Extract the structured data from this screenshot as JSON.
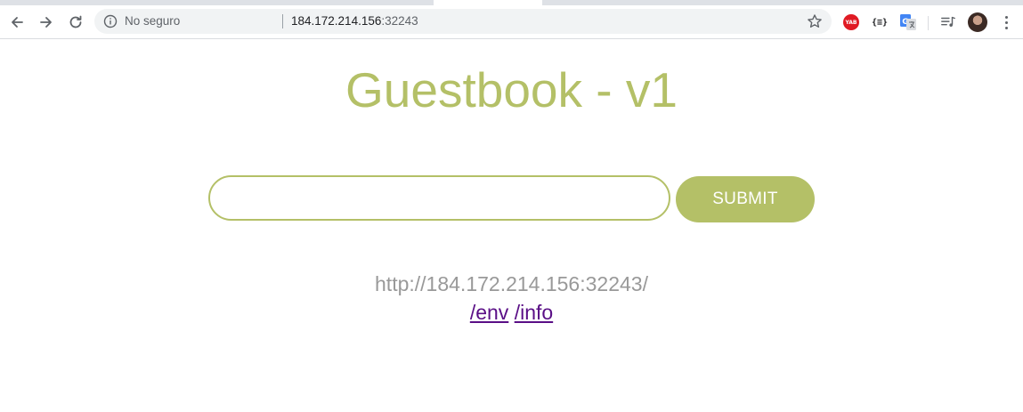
{
  "browser": {
    "security_label": "No seguro",
    "url_host": "184.172.214.156",
    "url_port": ":32243",
    "extensions": {
      "yab_label": "YAB",
      "json_label": "{≡}"
    },
    "icons": [
      "back-arrow-icon",
      "forward-arrow-icon",
      "reload-icon",
      "info-icon",
      "bookmark-star-icon",
      "translate-icon",
      "media-queue-icon",
      "profile-avatar",
      "kebab-menu-icon"
    ]
  },
  "page": {
    "title": "Guestbook - v1",
    "entry_value": "",
    "submit_label": "SUBMIT",
    "host_text": "http://184.172.214.156:32243/",
    "links": [
      {
        "label": "/env"
      },
      {
        "label": "/info"
      }
    ]
  },
  "colors": {
    "accent": "#b4c067",
    "host_text": "#999999",
    "link": "#5a0f86"
  }
}
